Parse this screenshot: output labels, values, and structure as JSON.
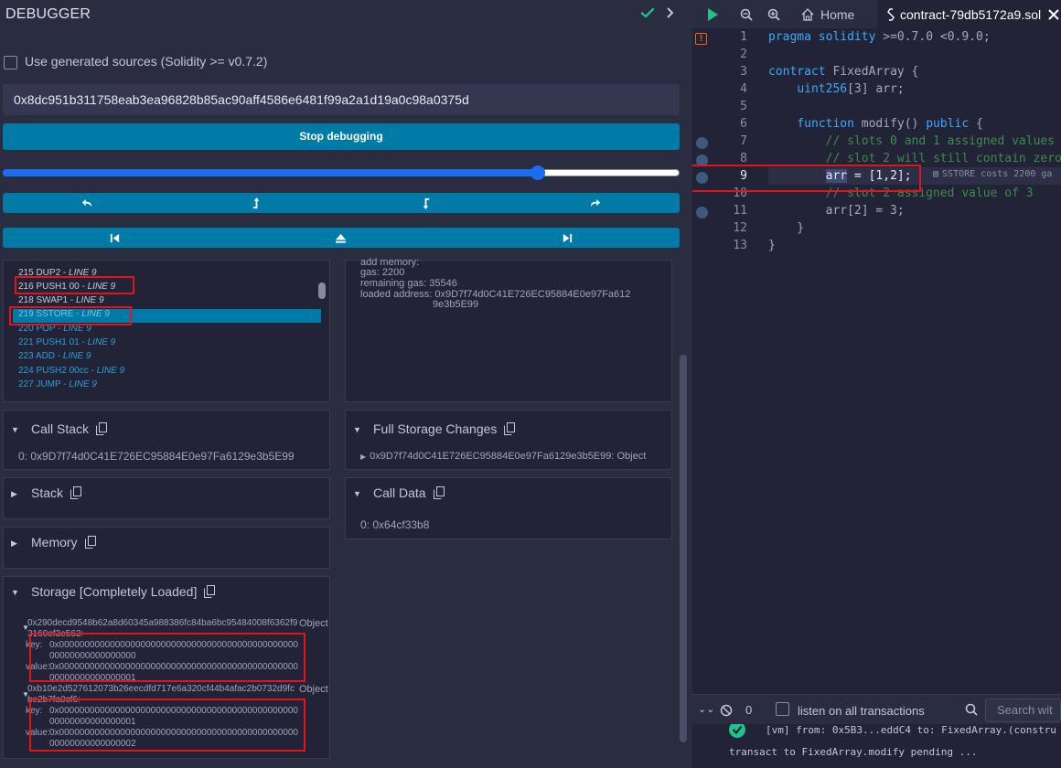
{
  "panel": {
    "title": "DEBUGGER",
    "use_generated_label": "Use generated sources (Solidity >= v0.7.2)",
    "tx_hash": "0x8dc951b311758eab3ea96828b85ac90aff4586e6481f99a2a1d19a0c98a0375d",
    "stop_label": "Stop debugging",
    "slider_fraction": 0.79
  },
  "opcodes": [
    {
      "text": "215 DUP2 - ",
      "line": "LINE 9"
    },
    {
      "text": "216 PUSH1 00 - ",
      "line": "LINE 9"
    },
    {
      "text": "218 SWAP1 - ",
      "line": "LINE 9"
    },
    {
      "text": "219 SSTORE - ",
      "line": "LINE 9"
    },
    {
      "text": "220 POP - ",
      "line": "LINE 9"
    },
    {
      "text": "221 PUSH1 01 - ",
      "line": "LINE 9"
    },
    {
      "text": "223 ADD - ",
      "line": "LINE 9"
    },
    {
      "text": "224 PUSH2 00cc - ",
      "line": "LINE 9"
    },
    {
      "text": "227 JUMP - ",
      "line": "LINE 9"
    }
  ],
  "step_details": {
    "add_memory": "add memory:",
    "gas_label": "gas:",
    "gas": "2200",
    "remaining_label": "remaining gas:",
    "remaining": "35546",
    "loaded_label": "loaded address:",
    "loaded_1": "0x9D7f74d0C41E726EC95884E0e97Fa612",
    "loaded_2": "9e3b5E99"
  },
  "call_stack": {
    "title": "Call Stack",
    "value": "0: 0x9D7f74d0C41E726EC95884E0e97Fa6129e3b5E99"
  },
  "stack": {
    "title": "Stack"
  },
  "memory": {
    "title": "Memory"
  },
  "full_storage": {
    "title": "Full Storage Changes",
    "value": "0x9D7f74d0C41E726EC95884E0e97Fa6129e3b5E99: Object"
  },
  "call_data": {
    "title": "Call Data",
    "value": "0: 0x64cf33b8"
  },
  "storage": {
    "title": "Storage [Completely Loaded]",
    "items": [
      {
        "slot": "0x290decd9548b62a8d60345a988386fc84ba6bc95484008f6362f93160ef3e563:",
        "obj": "Object",
        "key_label": "key:",
        "key": "0x0000000000000000000000000000000000000000000000000000000000000000",
        "value_label": "value:",
        "value": "0x0000000000000000000000000000000000000000000000000000000000000001"
      },
      {
        "slot": "0xb10e2d527612073b26eecdfd717e6a320cf44b4afac2b0732d9fcbe2b7fa0cf6:",
        "obj": "Object",
        "key_label": "key:",
        "key": "0x0000000000000000000000000000000000000000000000000000000000000001",
        "value_label": "value:",
        "value": "0x0000000000000000000000000000000000000000000000000000000000000002"
      }
    ]
  },
  "tabs": {
    "home": "Home",
    "file": "contract-79db5172a9.sol"
  },
  "editor": {
    "lines": [
      "1",
      "2",
      "3",
      "4",
      "5",
      "6",
      "7",
      "8",
      "9",
      "10",
      "11",
      "12",
      "13"
    ],
    "annotation": "SSTORE costs 2200 ga"
  },
  "terminal": {
    "count": "0",
    "listen_label": "listen on all transactions",
    "search_placeholder": "Search wit",
    "log1_prefix": "[vm]",
    "log1_from": "from: 0x5B3...eddC4 to: FixedArray.(constru",
    "log2": "transact to FixedArray.modify pending ..."
  },
  "colors": {
    "accent": "#007aa6",
    "highlight": "#e3141e",
    "success": "#1ec28b"
  }
}
